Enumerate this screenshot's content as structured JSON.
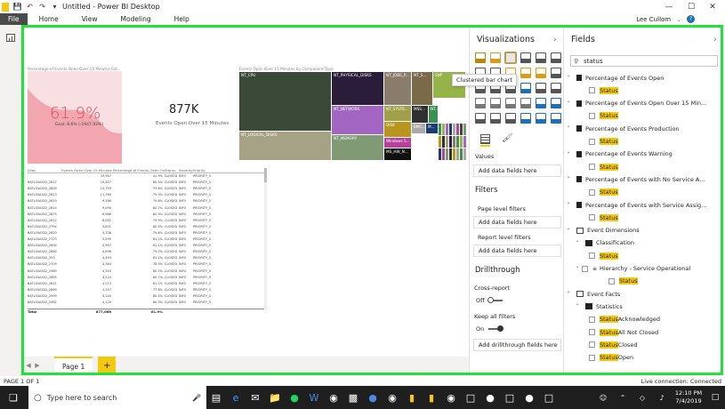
{
  "window": {
    "title": "Untitled - Power BI Desktop",
    "user": "Lee Cullom"
  },
  "ribbon": {
    "tabs": [
      "File",
      "Home",
      "View",
      "Modeling",
      "Help"
    ]
  },
  "visuals": {
    "gauge_title": "Percentage of Events Open Over 15 Minutes Ext...",
    "gauge_value": "61.9%",
    "gauge_sub": "Goal: 8.6% (-1947.93%)",
    "gauge_fill_pct": 0.619,
    "card_value": "877K",
    "card_label": "Events Open Over 15 Minutes",
    "treemap_title": "Events Open Over 15 Minutes by Component Type",
    "treemap_cells": [
      {
        "label": "NT_CPU",
        "color": "#3b4a38"
      },
      {
        "label": "NT_LOGICAL_DISKS",
        "color": "#a6a285"
      },
      {
        "label": "NT_PHYSICAL_DISKS",
        "color": "#2a1d3a"
      },
      {
        "label": "NT_NETWORK",
        "color": "#a365c2"
      },
      {
        "label": "NT_MEMORY",
        "color": "#7f9a75"
      },
      {
        "label": "NT_JOBS_P...",
        "color": "#8a7c6b"
      },
      {
        "label": "NT_SYSTE...",
        "color": "#a0a04a"
      },
      {
        "label": "DISK",
        "color": "#b8961e"
      },
      {
        "label": "Windows S...",
        "color": "#b8409d"
      },
      {
        "label": "MS_HW_N...",
        "color": "#111111"
      },
      {
        "label": "NT_S...",
        "color": "#7a6a4a"
      },
      {
        "label": "SNP",
        "color": "#96b34a"
      },
      {
        "label": "MSS...",
        "color": "#303030"
      },
      {
        "label": "NT...",
        "color": "#3e8f52"
      },
      {
        "label": "BMC...",
        "color": "#aaaaaa"
      },
      {
        "label": "M...",
        "color": "#1c3b73"
      }
    ],
    "table": {
      "headers": [
        "Alias",
        "Events Open Over 15 Minutes",
        "Percentage of Events Open Over 15 Minutes",
        "Status",
        "Severity",
        "Priority"
      ],
      "rows": [
        [
          "",
          "33,947",
          "41.9%",
          "CLOSED",
          "INFO",
          "PRIORITY_5"
        ],
        [
          "BATLS0AS02_2817",
          "19,637",
          "80.5%",
          "CLOSED",
          "INFO",
          "PRIORITY_5"
        ],
        [
          "BATLS0AS02_2809",
          "12,793",
          "79.6%",
          "CLOSED",
          "INFO",
          "PRIORITY_5"
        ],
        [
          "BATLS0AS02_2813",
          "11,760",
          "79.3%",
          "CLOSED",
          "INFO",
          "PRIORITY_5"
        ],
        [
          "BATLS0AS02_2819",
          "9,586",
          "79.6%",
          "CLOSED",
          "INFO",
          "PRIORITY_5"
        ],
        [
          "BATLS0AS02_2814",
          "9,090",
          "80.7%",
          "CLOSED",
          "INFO",
          "PRIORITY_5"
        ],
        [
          "BATLS0AS02_2875",
          "6,986",
          "80.9%",
          "CLOSED",
          "INFO",
          "PRIORITY_5"
        ],
        [
          "BATLS0AS02_2812",
          "6,062",
          "79.9%",
          "CLOSED",
          "INFO",
          "PRIORITY_5"
        ],
        [
          "BATLS0AS02_2794",
          "5,801",
          "80.5%",
          "CLOSED",
          "INFO",
          "PRIORITY_5"
        ],
        [
          "BATLS0AS02_2820",
          "5,338",
          "79.6%",
          "CLOSED",
          "INFO",
          "PRIORITY_5"
        ],
        [
          "BATLS0AS02_2723",
          "5,295",
          "81.1%",
          "CLOSED",
          "INFO",
          "PRIORITY_5"
        ],
        [
          "BATLS0AS02_2894",
          "4,997",
          "81.1%",
          "CLOSED",
          "INFO",
          "PRIORITY_5"
        ],
        [
          "BATLS0AS02_2880",
          "4,896",
          "79.7%",
          "CLOSED",
          "INFO",
          "PRIORITY_5"
        ],
        [
          "BATLS0AS02_353",
          "4,493",
          "81.2%",
          "CLOSED",
          "INFO",
          "PRIORITY_5"
        ],
        [
          "BATLS0AS02_2709",
          "4,364",
          "78.5%",
          "CLOSED",
          "INFO",
          "PRIORITY_5"
        ],
        [
          "BATLS0AS02_2969",
          "4,343",
          "80.7%",
          "CLOSED",
          "INFO",
          "PRIORITY_5"
        ],
        [
          "BATLS0AS02_2805",
          "4,224",
          "80.7%",
          "CLOSED",
          "INFO",
          "PRIORITY_5"
        ],
        [
          "BATLS0AS02_2811",
          "4,213",
          "81.1%",
          "CLOSED",
          "INFO",
          "PRIORITY_5"
        ],
        [
          "BATLS0AS02_2869",
          "4,197",
          "77.8%",
          "CLOSED",
          "INFO",
          "PRIORITY_5"
        ],
        [
          "BATLS0AS02_2999",
          "4,140",
          "80.5%",
          "CLOSED",
          "INFO",
          "PRIORITY_5"
        ],
        [
          "BATLS0AS02_2962",
          "4,129",
          "80.3%",
          "CLOSED",
          "INFO",
          "PRIORITY_5"
        ]
      ],
      "total_label": "Total",
      "total_events": "877,066",
      "total_pct": "61.9%"
    }
  },
  "pages": {
    "tab": "Page 1",
    "add": "+"
  },
  "status": {
    "left": "PAGE 1 OF 1",
    "right": "Live connection: Connected"
  },
  "viz": {
    "title": "Visualizations",
    "tooltip": "Clustered bar chart",
    "values_label": "Values",
    "add_data": "Add data fields here",
    "filters_title": "Filters",
    "page_filters": "Page level filters",
    "page_add": "Add data fields here",
    "report_filters": "Report level filters",
    "report_add": "Add data fields here",
    "drill_title": "Drillthrough",
    "cross_report": "Cross-report",
    "off": "Off",
    "keep_filters": "Keep all filters",
    "on": "On",
    "drill_add": "Add drillthrough fields here",
    "icon_colors": [
      "#b8860b",
      "#d99b1a",
      "#d99b1a",
      "#555",
      "#555",
      "#555",
      "#555",
      "#555",
      "#d99b1a",
      "#d99b1a",
      "#d99b1a",
      "#555",
      "#555",
      "#555",
      "#555",
      "#1f6fb2",
      "#555",
      "#555",
      "#777",
      "#777",
      "#777",
      "#777",
      "#1f6fb2",
      "#1f6fb2",
      "#555",
      "#555",
      "#555",
      "#1f6fb2",
      "#1f6fb2",
      "#1f6fb2"
    ]
  },
  "fields": {
    "title": "Fields",
    "search": "status",
    "rows": [
      {
        "type": "measure",
        "text": "Percentage of Events Open"
      },
      {
        "type": "field",
        "text": "Status"
      },
      {
        "type": "measure",
        "text": "Percentage of Events Open Over 15 Min..."
      },
      {
        "type": "field",
        "text": "Status"
      },
      {
        "type": "measure",
        "text": "Percentage of Events Production"
      },
      {
        "type": "field",
        "text": "Status"
      },
      {
        "type": "measure",
        "text": "Percentage of Events Warning"
      },
      {
        "type": "field",
        "text": "Status"
      },
      {
        "type": "measure",
        "text": "Percentage of Events with No Service A..."
      },
      {
        "type": "field",
        "text": "Status"
      },
      {
        "type": "measure",
        "text": "Percentage of Events with Service Assig..."
      },
      {
        "type": "field",
        "text": "Status"
      },
      {
        "type": "table",
        "text": "Event Dimensions"
      },
      {
        "type": "folder",
        "text": "Classification"
      },
      {
        "type": "field",
        "text": "Status"
      },
      {
        "type": "hier",
        "text": "Hierarchy - Service Operational"
      },
      {
        "type": "field2",
        "text": "Status"
      },
      {
        "type": "table",
        "text": "Event Facts"
      },
      {
        "type": "folder",
        "text": "Statistics"
      },
      {
        "type": "field",
        "hl": "Status",
        "rest": " Acknowledged"
      },
      {
        "type": "field",
        "hl": "Status",
        "rest": " All Not Closed"
      },
      {
        "type": "field",
        "hl": "Status",
        "rest": " Closed"
      },
      {
        "type": "field",
        "hl": "Status",
        "rest": " Open"
      }
    ]
  },
  "taskbar": {
    "search": "Type here to search",
    "time": "12:10 PM",
    "date": "7/4/2019"
  }
}
